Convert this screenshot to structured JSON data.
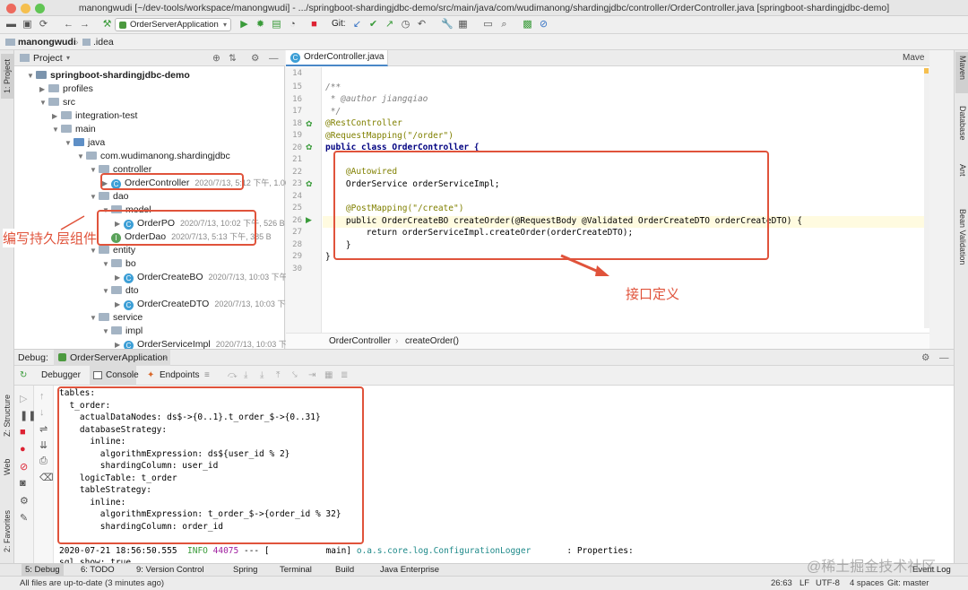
{
  "window": {
    "title": "manongwudi [~/dev-tools/workspace/manongwudi] - .../springboot-shardingjdbc-demo/src/main/java/com/wudimanong/shardingjdbc/controller/OrderController.java [springboot-shardingjdbc-demo]"
  },
  "toolbar": {
    "run_config": "OrderServerApplication",
    "git_label": "Git:"
  },
  "nav": {
    "crumbs": [
      "manongwudi",
      ".idea"
    ]
  },
  "left_strip": {
    "project": "1: Project",
    "structure": "Z: Structure",
    "web": "Web",
    "favorites": "2: Favorites"
  },
  "right_strip": {
    "maven": "Maven",
    "database": "Database",
    "ant": "Ant",
    "bean": "Bean Validation"
  },
  "project": {
    "header": "Project",
    "tree": [
      {
        "label": "springboot-shardingjdbc-demo",
        "bold": true
      },
      {
        "label": "profiles"
      },
      {
        "label": "src"
      },
      {
        "label": "integration-test"
      },
      {
        "label": "main"
      },
      {
        "label": "java"
      },
      {
        "label": "com.wudimanong.shardingjdbc"
      },
      {
        "label": "controller"
      },
      {
        "label": "OrderController",
        "meta": "2020/7/13, 5:12 下午, 1.06"
      },
      {
        "label": "dao"
      },
      {
        "label": "model"
      },
      {
        "label": "OrderPO",
        "meta": "2020/7/13, 10:02 下午, 526 B"
      },
      {
        "label": "OrderDao",
        "meta": "2020/7/13, 5:13 下午, 385 B"
      },
      {
        "label": "entity"
      },
      {
        "label": "bo"
      },
      {
        "label": "OrderCreateBO",
        "meta": "2020/7/13, 10:03 下午,"
      },
      {
        "label": "dto"
      },
      {
        "label": "OrderCreateDTO",
        "meta": "2020/7/13, 10:03 下午"
      },
      {
        "label": "service"
      },
      {
        "label": "impl"
      },
      {
        "label": "OrderServiceImpl",
        "meta": "2020/7/13, 10:03 下午"
      }
    ]
  },
  "editor": {
    "tab": "OrderController.java",
    "right_tab": "Mave",
    "line_numbers": [
      "14",
      "15",
      "16",
      "17",
      "18",
      "19",
      "20",
      "21",
      "22",
      "23",
      "24",
      "25",
      "26",
      "27",
      "28",
      "29",
      "30"
    ],
    "lines": [
      "/**",
      " * @author jiangqiao",
      " */",
      "@RestController",
      "@RequestMapping(\"/order\")",
      "public class OrderController {",
      "",
      "    @Autowired",
      "    OrderService orderServiceImpl;",
      "",
      "    @PostMapping(\"/create\")",
      "    public OrderCreateBO createOrder(@RequestBody @Validated OrderCreateDTO orderCreateDTO) {",
      "        return orderServiceImpl.createOrder(orderCreateDTO);",
      "    }",
      "}"
    ],
    "breadcrumb": [
      "OrderController",
      "createOrder()"
    ]
  },
  "debug": {
    "label": "Debug:",
    "config": "OrderServerApplication",
    "tabs": [
      "Debugger",
      "Console",
      "Endpoints"
    ],
    "console": [
      "tables:",
      "  t_order:",
      "    actualDataNodes: ds$->{0..1}.t_order_$->{0..31}",
      "    databaseStrategy:",
      "      inline:",
      "        algorithmExpression: ds${user_id % 2}",
      "        shardingColumn: user_id",
      "    logicTable: t_order",
      "    tableStrategy:",
      "      inline:",
      "        algorithmExpression: t_order_$->{order_id % 32}",
      "        shardingColumn: order_id"
    ],
    "log": {
      "time": "2020-07-21 18:56:50.555",
      "level": "INFO",
      "pid": "44075",
      "sep": "--- [",
      "thread": "main]",
      "logger": "o.a.s.core.log.ConfigurationLogger",
      "msg": ": Properties:"
    },
    "log2": "sql.show: true"
  },
  "annotations": {
    "persist": "编写持久层组件",
    "interface": "接口定义"
  },
  "bottom_tabs": [
    "5: Debug",
    "6: TODO",
    "9: Version Control",
    "Spring",
    "Terminal",
    "Build",
    "Java Enterprise",
    "Event Log"
  ],
  "status": {
    "message": "All files are up-to-date (3 minutes ago)",
    "position": "26:63",
    "line_sep": "LF",
    "encoding": "UTF-8",
    "indent": "4 spaces",
    "git": "Git: master"
  },
  "watermark": "@稀土掘金技术社区",
  "colors": {
    "annotation_red": "#e0533b",
    "class_icon": "#3d9fd6",
    "keyword": "#000080",
    "annotation": "#808000",
    "string": "#008000"
  }
}
